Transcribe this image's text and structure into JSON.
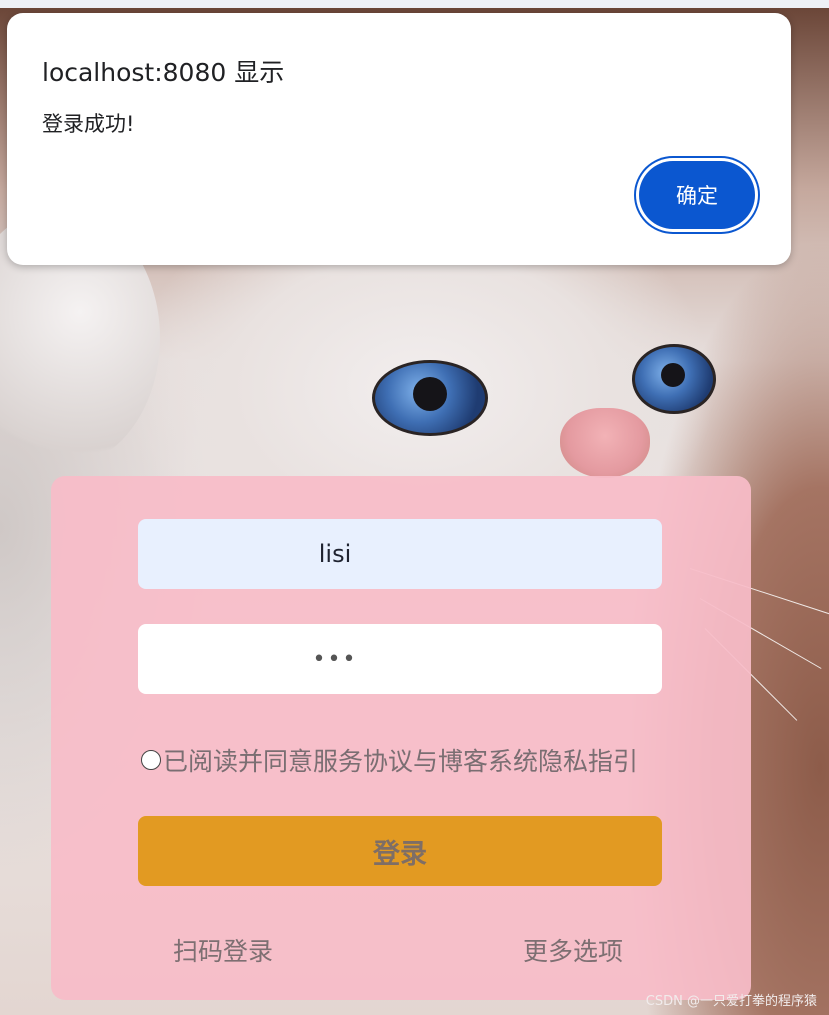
{
  "dialog": {
    "title": "localhost:8080 显示",
    "message": "登录成功!",
    "ok_label": "确定"
  },
  "login": {
    "username_value": "lisi",
    "password_mask": "•••",
    "agreement_text": "已阅读并同意服务协议与博客系统隐私指引",
    "submit_label": "登录",
    "qr_login_label": "扫码登录",
    "more_options_label": "更多选项"
  },
  "watermark": "CSDN @一只爱打拳的程序猿",
  "colors": {
    "dialog_button": "#0b57d0",
    "card_background": "#f8bcc8",
    "login_button": "#e29a22",
    "username_field": "#e8f0fe"
  }
}
